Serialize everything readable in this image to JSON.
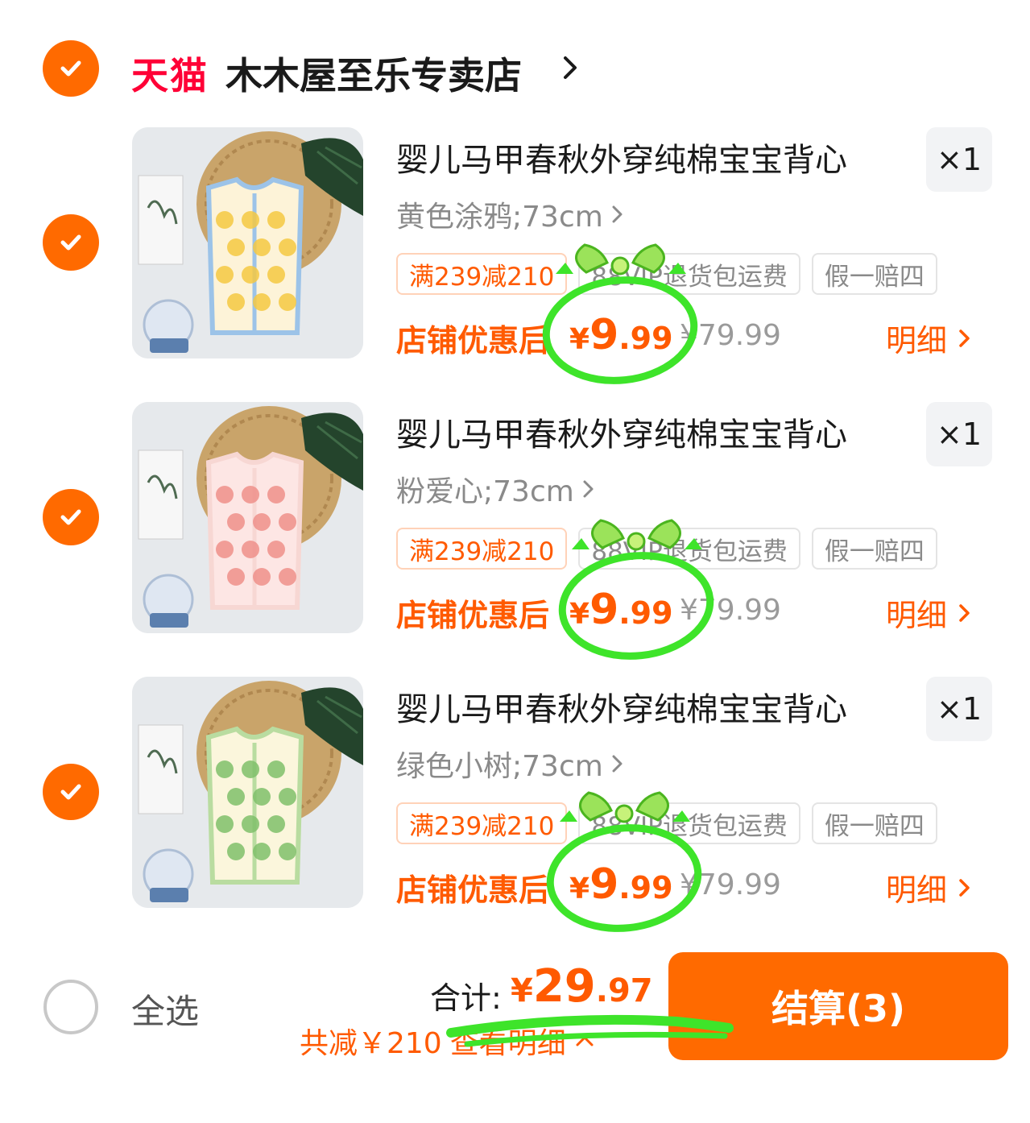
{
  "shop": {
    "logo_text": "天猫",
    "name": "木木屋至乐专卖店"
  },
  "items": [
    {
      "title": "婴儿马甲春秋外穿纯棉宝宝背心",
      "quantity": "×1",
      "sku": "黄色涂鸦;73cm",
      "tags": [
        "满239减210",
        "88VIP退货包运费",
        "假一赔四"
      ],
      "store_deal": "店铺优惠后",
      "deal_price": {
        "currency": "¥",
        "integer": "9",
        "decimal": ".99"
      },
      "original_price": "¥79.99",
      "detail_label": "明细",
      "image_palette": {
        "bg": "#e6e9ec",
        "vest": "#fdf3d8",
        "trim": "#9cc3e8",
        "pattern": "#f5c842"
      }
    },
    {
      "title": "婴儿马甲春秋外穿纯棉宝宝背心",
      "quantity": "×1",
      "sku": "粉爱心;73cm",
      "tags": [
        "满239减210",
        "88VIP退货包运费",
        "假一赔四"
      ],
      "store_deal": "店铺优惠后",
      "deal_price": {
        "currency": "¥",
        "integer": "9",
        "decimal": ".99"
      },
      "original_price": "¥79.99",
      "detail_label": "明细",
      "image_palette": {
        "bg": "#e6e9ec",
        "vest": "#fde6e4",
        "trim": "#f7d7d3",
        "pattern": "#ef8f8a"
      }
    },
    {
      "title": "婴儿马甲春秋外穿纯棉宝宝背心",
      "quantity": "×1",
      "sku": "绿色小树;73cm",
      "tags": [
        "满239减210",
        "88VIP退货包运费",
        "假一赔四"
      ],
      "store_deal": "店铺优惠后",
      "deal_price": {
        "currency": "¥",
        "integer": "9",
        "decimal": ".99"
      },
      "original_price": "¥79.99",
      "detail_label": "明细",
      "image_palette": {
        "bg": "#e6e9ec",
        "vest": "#fbf6dc",
        "trim": "#b9dca0",
        "pattern": "#7fbf6a"
      }
    }
  ],
  "footer": {
    "select_all": "全选",
    "total_label": "合计:",
    "total_price": {
      "currency": "¥",
      "integer": "29",
      "decimal": ".97"
    },
    "saved_text": "共减￥210",
    "view_detail": "查看明细",
    "checkout_label": "结算(3)"
  },
  "colors": {
    "accent": "#ff6a00",
    "price": "#ff5a00",
    "tmall_red": "#ff0036",
    "doodle_green": "#3ee42a"
  }
}
